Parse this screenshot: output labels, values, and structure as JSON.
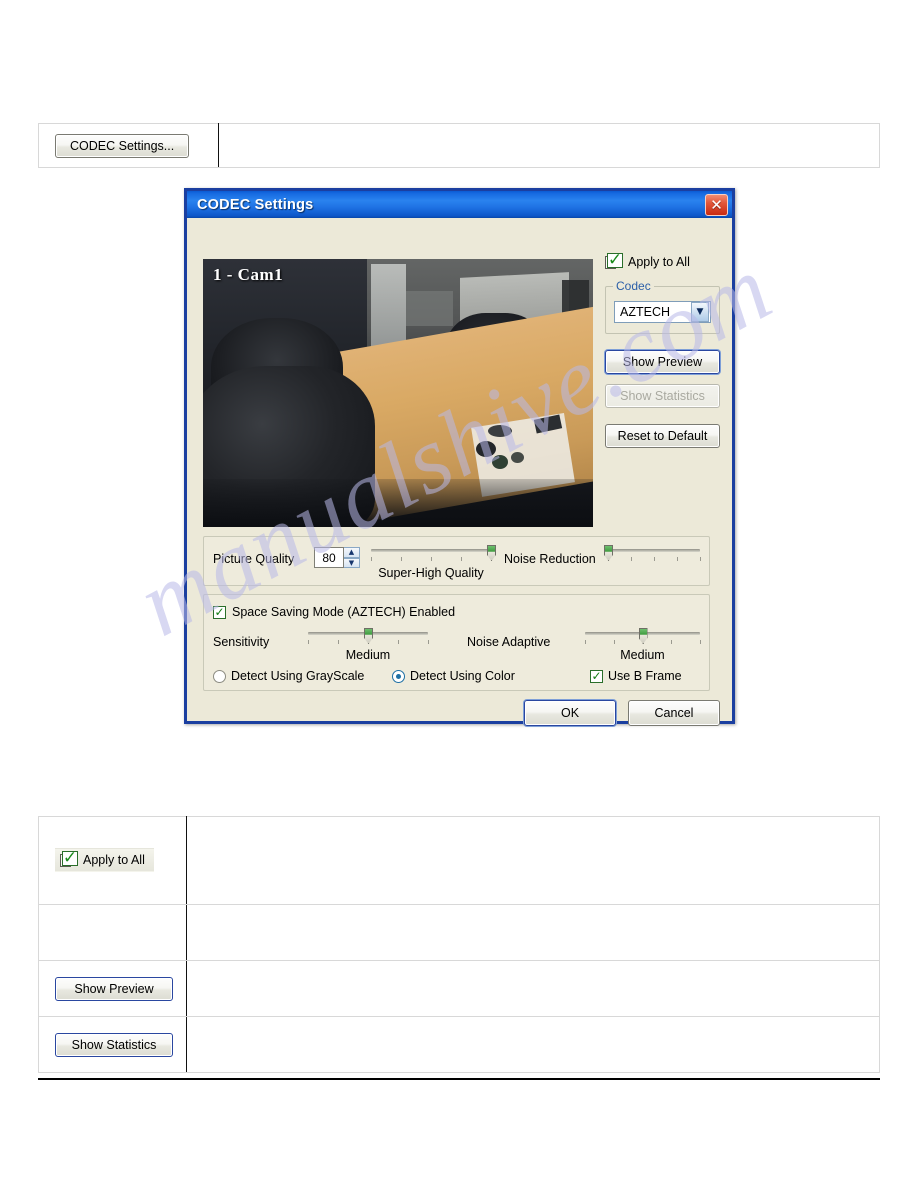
{
  "page": {
    "watermark": "manualshive.com"
  },
  "top_table": {
    "button_label": "CODEC Settings..."
  },
  "dialog": {
    "title": "CODEC Settings",
    "close_icon": "close-icon",
    "video": {
      "camera_label": "1 - Cam1"
    },
    "apply_to_all": {
      "label": "Apply to All",
      "icon": "apply-to-all-icon"
    },
    "codec_group": {
      "title": "Codec",
      "selected": "AZTECH",
      "options": [
        "AZTECH"
      ],
      "dropdown_icon": "chevron-down-icon"
    },
    "buttons": {
      "show_preview": "Show Preview",
      "show_statistics": "Show Statistics",
      "reset_to_default": "Reset to Default",
      "ok": "OK",
      "cancel": "Cancel"
    },
    "quality_panel": {
      "picture_quality_label": "Picture Quality",
      "picture_quality_value": "80",
      "quality_slider_label": "Super-High Quality",
      "quality_slider_position_pct": 100,
      "noise_reduction_label": "Noise Reduction",
      "noise_reduction_position_pct": 0
    },
    "space_saving_panel": {
      "enabled_label": "Space Saving Mode (AZTECH) Enabled",
      "enabled_checked": true,
      "sensitivity_label": "Sensitivity",
      "sensitivity_value_label": "Medium",
      "sensitivity_position_pct": 50,
      "noise_adaptive_label": "Noise Adaptive",
      "noise_adaptive_value_label": "Medium",
      "noise_adaptive_position_pct": 50,
      "detect_grayscale_label": "Detect Using GrayScale",
      "detect_grayscale_selected": false,
      "detect_color_label": "Detect Using Color",
      "detect_color_selected": true,
      "use_b_frame_label": "Use B Frame",
      "use_b_frame_checked": true
    }
  },
  "bottom_table": {
    "rows": [
      {
        "label": "Apply to All",
        "type": "icon-button"
      },
      {
        "label": "",
        "type": "empty"
      },
      {
        "label": "Show Preview",
        "type": "button"
      },
      {
        "label": "Show Statistics",
        "type": "button"
      }
    ]
  }
}
